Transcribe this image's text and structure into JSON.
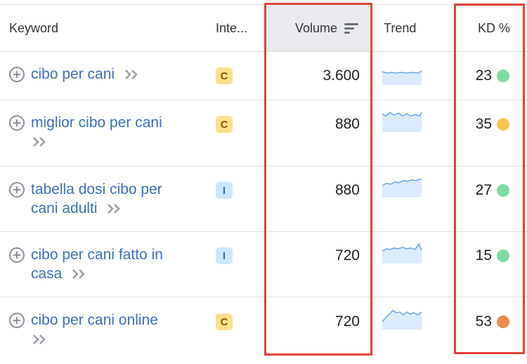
{
  "header": {
    "keyword": "Keyword",
    "intent": "Inte...",
    "volume": "Volume",
    "trend": "Trend",
    "kd": "KD %"
  },
  "rows": [
    {
      "keyword_lines": [
        "cibo per cani"
      ],
      "intent": "C",
      "intent_type": "commercial",
      "volume": "3.600",
      "kd": "23",
      "kd_color": "#7fdba3"
    },
    {
      "keyword_lines": [
        "miglior cibo per cani"
      ],
      "intent": "C",
      "intent_type": "commercial",
      "volume": "880",
      "kd": "35",
      "kd_color": "#f6c453"
    },
    {
      "keyword_lines": [
        "tabella dosi cibo per",
        "cani adulti"
      ],
      "intent": "I",
      "intent_type": "informational",
      "volume": "880",
      "kd": "27",
      "kd_color": "#7fdba3"
    },
    {
      "keyword_lines": [
        "cibo per cani fatto in",
        "casa"
      ],
      "intent": "I",
      "intent_type": "informational",
      "volume": "720",
      "kd": "15",
      "kd_color": "#7fdba3"
    },
    {
      "keyword_lines": [
        "cibo per cani online"
      ],
      "intent": "C",
      "intent_type": "commercial",
      "volume": "720",
      "kd": "53",
      "kd_color": "#ee8a50"
    }
  ],
  "icons": {
    "add": "plus-circle-icon",
    "more": "double-chevron-right-icon",
    "sort": "sort-descending-icon"
  },
  "colors": {
    "link": "#3d6fb8",
    "highlight_border": "#e0423a",
    "sorted_header_bg": "#e9eaee",
    "trend_line": "#6aa3e0",
    "trend_fill": "#dcebfb"
  }
}
